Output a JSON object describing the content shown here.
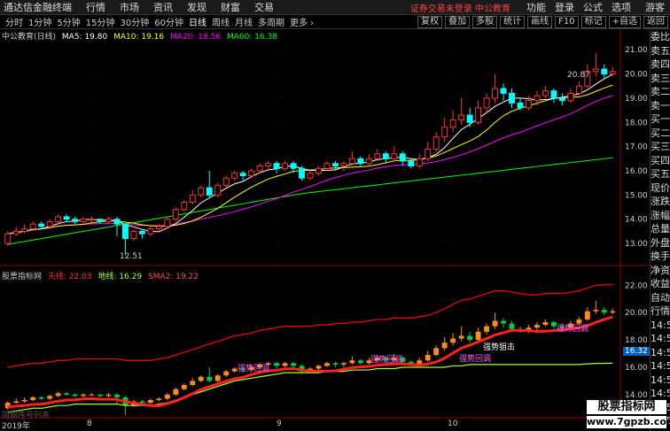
{
  "titlebar": {
    "app": "通达信金融终端",
    "menus": [
      "行情",
      "市场",
      "资讯",
      "发现",
      "财富",
      "交易"
    ],
    "notice": "证券交易未登录",
    "stock_link": "中公教育",
    "right": [
      "功能",
      "登录",
      "公式",
      "选项",
      "游客"
    ]
  },
  "toolbar": {
    "periods": [
      "分时",
      "1分钟",
      "5分钟",
      "15分钟",
      "30分钟",
      "60分钟",
      "日线",
      "周线",
      "月线",
      "多周期",
      "更多"
    ],
    "active": "日线",
    "right_buttons": [
      "复权",
      "叠加",
      "多股",
      "统计",
      "画线",
      "F10",
      "标记",
      "+自选",
      "返回"
    ]
  },
  "main": {
    "title": "中公教育(日线)",
    "ma5_label": "MA5: 19.80",
    "ma10_label": "MA10: 19.16",
    "ma20_label": "MA20: 18.56",
    "ma60_label": "MA60: 16.38",
    "high_label": "20.87",
    "low_label": "12.51",
    "price_ticks": [
      "21.00",
      "20.00",
      "19.00",
      "18.00",
      "17.00",
      "16.00",
      "15.00",
      "14.00",
      "13.00"
    ]
  },
  "indicator": {
    "title": "股票指标网",
    "tianxian_label": "天线: 22.03",
    "dixian_label": "地线: 16.29",
    "sma2_label": "SMA2: 19.22",
    "ticks": [
      "22.00",
      "20.00",
      "18.00",
      "16.00",
      "14.00"
    ],
    "price_tag": "16.32",
    "annotations": [
      {
        "label": "强势回调"
      },
      {
        "label": "强势回调"
      },
      {
        "label": "强势回调"
      },
      {
        "label": "强势狙击"
      },
      {
        "label": "强势回调"
      }
    ],
    "footer_label": "周期序号列表",
    "dates": [
      "2019年",
      "8",
      "9",
      "10"
    ]
  },
  "side_panel": [
    "委比",
    "卖五",
    "卖四",
    "卖三",
    "卖二",
    "卖一",
    "买一",
    "买二",
    "买三",
    "买四",
    "买五",
    "现价",
    "涨跌",
    "涨幅",
    "总量",
    "外盘",
    "换手",
    "净资",
    "收益",
    "",
    "自动",
    "行情",
    "14:5",
    "14:5",
    "14:5",
    "14:5",
    "14:5",
    "14:5",
    "14:5",
    "14:5",
    "14:5",
    "14:5",
    "14:5",
    "14:5"
  ],
  "watermark": {
    "line1": "股票指标网",
    "line2": "www.7gpzb.com"
  },
  "colors": {
    "ma5": "#ffffff",
    "ma10": "#ffff00",
    "ma20": "#ff00ff",
    "ma60": "#00ff00",
    "up": "#ff3333",
    "down": "#00ffff",
    "tianxian": "#ff0000",
    "dixian": "#aaff33",
    "sma2": "#ff2020"
  },
  "chart_data": {
    "type": "candlestick",
    "price_range": [
      12.6,
      21.3
    ],
    "indicator_range": [
      12.5,
      22.8
    ],
    "candles": [
      [
        13.0,
        13.4,
        12.9,
        13.5
      ],
      [
        13.4,
        13.5,
        13.3,
        13.7
      ],
      [
        13.5,
        13.6,
        13.4,
        13.8
      ],
      [
        13.6,
        13.8,
        13.5,
        13.9
      ],
      [
        13.8,
        13.7,
        13.6,
        13.9
      ],
      [
        13.7,
        13.9,
        13.6,
        14.0
      ],
      [
        13.9,
        14.1,
        13.8,
        14.2
      ],
      [
        14.1,
        14.0,
        13.9,
        14.2
      ],
      [
        14.0,
        13.9,
        13.8,
        14.1
      ],
      [
        13.9,
        14.0,
        13.8,
        14.1
      ],
      [
        14.0,
        14.0,
        13.9,
        14.1
      ],
      [
        14.0,
        13.9,
        13.8,
        14.0
      ],
      [
        13.9,
        14.0,
        13.8,
        14.1
      ],
      [
        14.0,
        13.8,
        13.3,
        14.1
      ],
      [
        13.8,
        13.2,
        12.51,
        13.9
      ],
      [
        13.2,
        13.5,
        13.1,
        13.6
      ],
      [
        13.5,
        13.4,
        13.2,
        13.6
      ],
      [
        13.4,
        13.6,
        13.3,
        13.7
      ],
      [
        13.6,
        13.7,
        13.5,
        13.8
      ],
      [
        13.7,
        14.0,
        13.6,
        14.1
      ],
      [
        14.0,
        14.4,
        13.9,
        14.5
      ],
      [
        14.4,
        14.7,
        14.3,
        14.8
      ],
      [
        14.7,
        15.0,
        14.6,
        15.2
      ],
      [
        15.0,
        15.3,
        14.9,
        15.4
      ],
      [
        15.3,
        15.0,
        14.9,
        16.0
      ],
      [
        15.0,
        15.4,
        14.9,
        15.5
      ],
      [
        15.4,
        15.7,
        15.3,
        15.8
      ],
      [
        15.7,
        15.9,
        15.6,
        16.0
      ],
      [
        15.9,
        15.8,
        15.6,
        16.0
      ],
      [
        15.8,
        16.0,
        15.7,
        16.1
      ],
      [
        16.0,
        16.2,
        15.9,
        16.3
      ],
      [
        16.2,
        16.3,
        16.1,
        16.4
      ],
      [
        16.3,
        16.1,
        15.9,
        16.4
      ],
      [
        16.1,
        16.3,
        16.0,
        16.4
      ],
      [
        16.3,
        16.1,
        15.9,
        16.4
      ],
      [
        16.1,
        15.7,
        15.6,
        16.2
      ],
      [
        15.7,
        15.9,
        15.6,
        16.0
      ],
      [
        15.9,
        16.1,
        15.8,
        16.2
      ],
      [
        16.1,
        16.3,
        16.0,
        16.4
      ],
      [
        16.3,
        16.2,
        16.0,
        16.4
      ],
      [
        16.2,
        16.3,
        16.0,
        16.4
      ],
      [
        16.3,
        16.5,
        16.2,
        16.8
      ],
      [
        16.5,
        16.3,
        16.2,
        16.6
      ],
      [
        16.3,
        16.5,
        16.2,
        16.7
      ],
      [
        16.5,
        16.7,
        16.4,
        16.9
      ],
      [
        16.7,
        16.5,
        16.3,
        16.8
      ],
      [
        16.5,
        16.7,
        16.4,
        17.0
      ],
      [
        16.7,
        16.4,
        16.2,
        16.8
      ],
      [
        16.4,
        16.2,
        16.1,
        16.5
      ],
      [
        16.2,
        16.5,
        16.1,
        16.7
      ],
      [
        16.5,
        16.9,
        16.4,
        17.2
      ],
      [
        16.9,
        17.4,
        16.8,
        17.6
      ],
      [
        17.4,
        17.8,
        17.2,
        18.2
      ],
      [
        17.8,
        18.1,
        17.6,
        18.5
      ],
      [
        18.1,
        18.3,
        17.9,
        19.0
      ],
      [
        18.3,
        18.0,
        17.8,
        18.6
      ],
      [
        18.0,
        18.6,
        17.9,
        18.9
      ],
      [
        18.6,
        19.0,
        18.4,
        19.2
      ],
      [
        19.0,
        19.4,
        18.8,
        20.0
      ],
      [
        19.4,
        19.2,
        18.9,
        19.6
      ],
      [
        19.2,
        18.8,
        18.6,
        19.4
      ],
      [
        18.8,
        18.6,
        18.5,
        19.0
      ],
      [
        18.6,
        18.9,
        18.5,
        19.1
      ],
      [
        18.9,
        19.1,
        18.7,
        19.3
      ],
      [
        19.1,
        19.3,
        19.0,
        19.5
      ],
      [
        19.3,
        19.0,
        18.8,
        19.4
      ],
      [
        19.0,
        18.9,
        18.7,
        19.2
      ],
      [
        18.9,
        19.2,
        18.8,
        19.4
      ],
      [
        19.2,
        19.5,
        19.1,
        19.7
      ],
      [
        19.5,
        20.1,
        19.4,
        20.4
      ],
      [
        20.1,
        20.2,
        19.9,
        20.87
      ],
      [
        20.2,
        20.0,
        19.8,
        20.4
      ],
      [
        20.0,
        20.1,
        19.9,
        20.3
      ]
    ],
    "ma60": [
      12.95,
      13.02,
      13.08,
      13.14,
      13.2,
      13.26,
      13.32,
      13.38,
      13.44,
      13.5,
      13.56,
      13.62,
      13.68,
      13.74,
      13.8,
      13.86,
      13.92,
      13.98,
      14.04,
      14.1,
      14.16,
      14.22,
      14.28,
      14.34,
      14.4,
      14.46,
      14.52,
      14.58,
      14.64,
      14.7,
      14.76,
      14.82,
      14.88,
      14.94,
      15.0,
      15.06,
      15.1,
      15.14,
      15.18,
      15.22,
      15.26,
      15.3,
      15.34,
      15.38,
      15.42,
      15.46,
      15.5,
      15.54,
      15.58,
      15.62,
      15.66,
      15.7,
      15.74,
      15.78,
      15.82,
      15.86,
      15.9,
      15.94,
      15.98,
      16.02,
      16.06,
      16.1,
      16.14,
      16.18,
      16.22,
      16.26,
      16.3,
      16.34,
      16.38,
      16.42,
      16.46,
      16.5,
      16.54
    ],
    "tianxian": [
      16.0,
      16.1,
      16.2,
      16.3,
      16.3,
      16.4,
      16.5,
      16.5,
      16.6,
      16.6,
      16.6,
      16.6,
      16.6,
      16.6,
      16.5,
      16.5,
      16.5,
      16.5,
      16.6,
      16.7,
      16.9,
      17.1,
      17.3,
      17.5,
      17.7,
      17.9,
      18.1,
      18.3,
      18.4,
      18.5,
      18.7,
      18.8,
      18.9,
      19.0,
      19.0,
      19.0,
      19.0,
      19.1,
      19.1,
      19.2,
      19.2,
      19.3,
      19.3,
      19.4,
      19.5,
      19.5,
      19.6,
      19.6,
      19.6,
      19.7,
      19.8,
      20.0,
      20.3,
      20.6,
      20.9,
      21.0,
      21.2,
      21.4,
      21.6,
      21.6,
      21.5,
      21.4,
      21.3,
      21.3,
      21.4,
      21.4,
      21.4,
      21.5,
      21.6,
      21.8,
      22.0,
      22.03,
      22.05
    ],
    "dixian": [
      12.7,
      12.8,
      12.9,
      13.0,
      13.0,
      13.1,
      13.2,
      13.2,
      13.3,
      13.3,
      13.3,
      13.3,
      13.3,
      13.3,
      13.2,
      13.2,
      13.2,
      13.2,
      13.3,
      13.4,
      13.6,
      13.8,
      14.0,
      14.2,
      14.4,
      14.6,
      14.8,
      15.0,
      15.1,
      15.2,
      15.3,
      15.4,
      15.5,
      15.6,
      15.6,
      15.6,
      15.6,
      15.6,
      15.7,
      15.7,
      15.7,
      15.8,
      15.8,
      15.8,
      15.9,
      15.9,
      15.9,
      16.0,
      16.0,
      16.0,
      16.0,
      16.0,
      16.0,
      16.1,
      16.1,
      16.2,
      16.2,
      16.2,
      16.2,
      16.2,
      16.2,
      16.2,
      16.2,
      16.2,
      16.2,
      16.2,
      16.2,
      16.2,
      16.2,
      16.25,
      16.28,
      16.29,
      16.3
    ]
  }
}
